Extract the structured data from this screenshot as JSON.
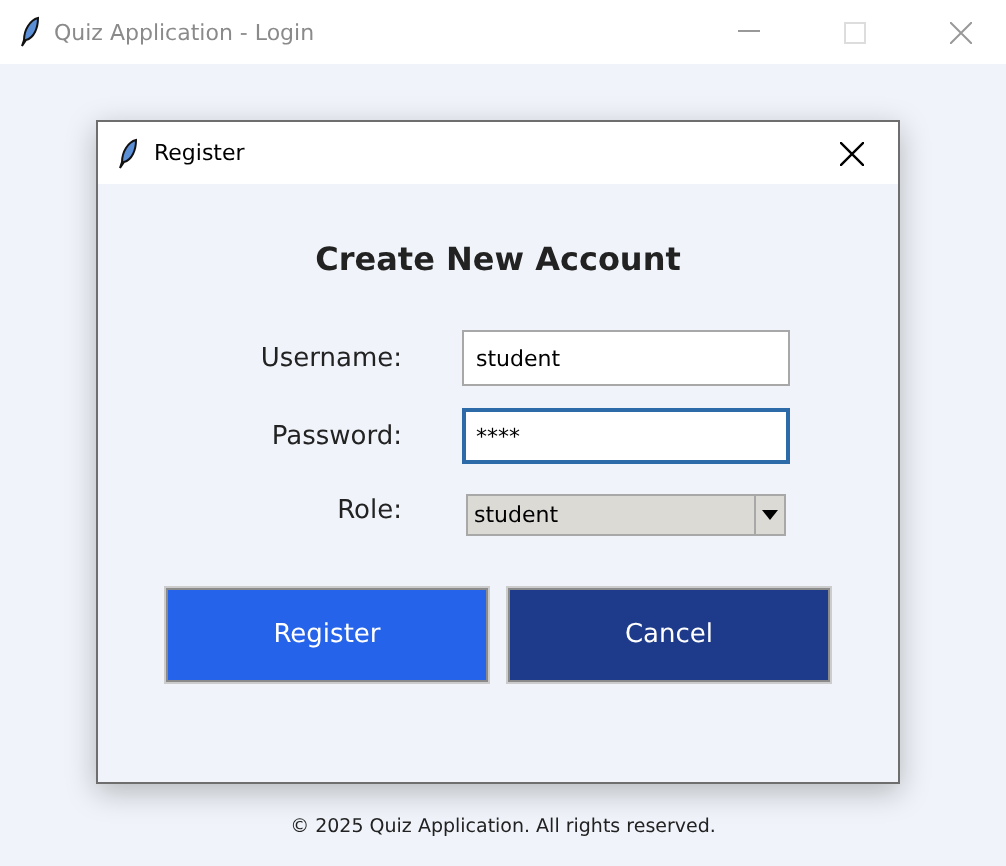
{
  "window": {
    "title": "Quiz Application - Login",
    "active": false
  },
  "dialog": {
    "title": "Register",
    "heading": "Create New Account",
    "fields": [
      {
        "kind": "text",
        "label": "Username:",
        "value": "student",
        "focused": false
      },
      {
        "kind": "text",
        "label": "Password:",
        "value": "****",
        "focused": true
      },
      {
        "kind": "select",
        "label": "Role:",
        "value": "student",
        "focused": false
      }
    ],
    "buttons": [
      {
        "label": "Register",
        "primary": true
      },
      {
        "label": "Cancel",
        "primary": false
      }
    ]
  },
  "footer": "© 2025 Quiz Application. All rights reserved."
}
